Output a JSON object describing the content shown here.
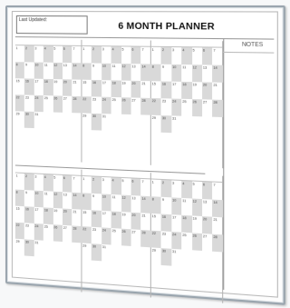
{
  "planner": {
    "title": "6 MONTH PLANNER",
    "last_updated": "Last Updated:",
    "notes": "NOTES"
  },
  "colors": {
    "frame": "#9aa5ae",
    "shade": "#d9d9d9"
  },
  "calendar": {
    "months": 6,
    "day_numbers": [
      1,
      2,
      3,
      4,
      5,
      6,
      7,
      8,
      9,
      10,
      11,
      12,
      13,
      14,
      15,
      16,
      17,
      18,
      19,
      20,
      21,
      22,
      23,
      24,
      25,
      26,
      27,
      28,
      29,
      30,
      31
    ]
  }
}
